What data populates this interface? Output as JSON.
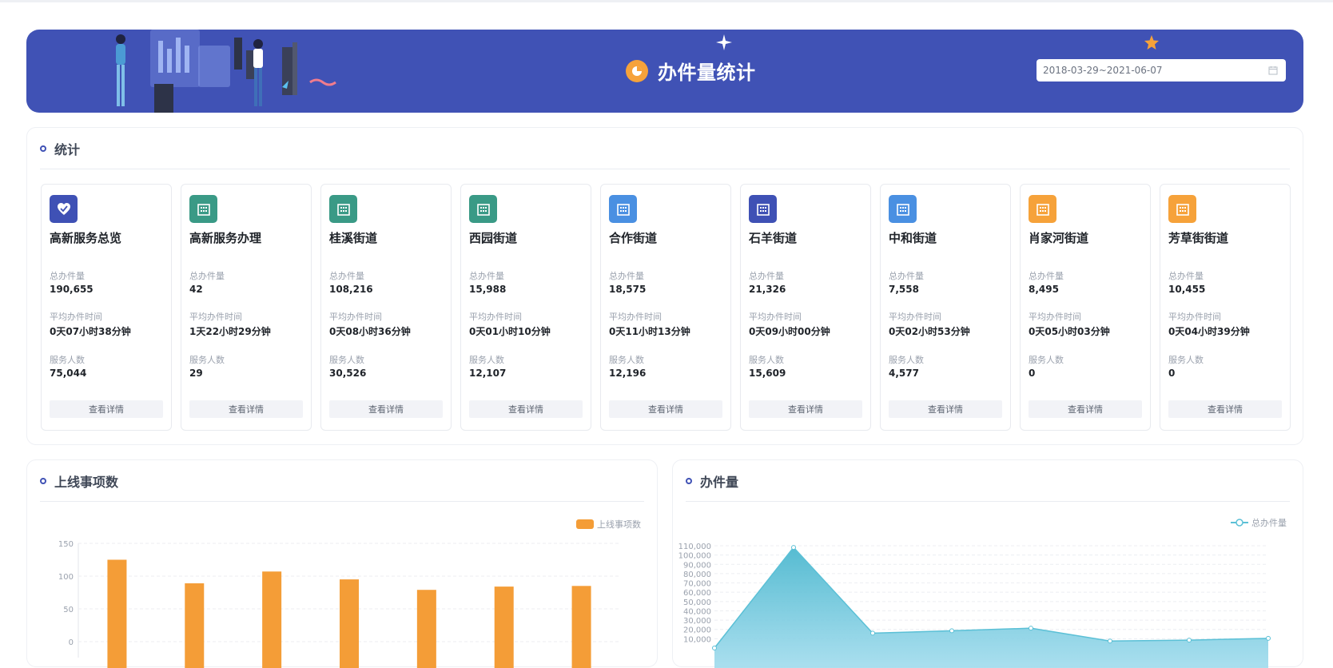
{
  "header": {
    "title": "办件量统计",
    "date_range": "2018-03-29~2021-06-07"
  },
  "stats": {
    "title": "统计",
    "label_total": "总办件量",
    "label_avg": "平均办件时间",
    "label_people": "服务人数",
    "detail_label": "查看详情",
    "cards": [
      {
        "name": "高新服务总览",
        "icon": "heart-icon",
        "color": "#3f51b5",
        "total": "190,655",
        "avg": "0天07小时38分钟",
        "people": "75,044"
      },
      {
        "name": "高新服务办理",
        "icon": "building-icon",
        "color": "#3a9a86",
        "total": "42",
        "avg": "1天22小时29分钟",
        "people": "29"
      },
      {
        "name": "桂溪街道",
        "icon": "building-icon",
        "color": "#3a9a86",
        "total": "108,216",
        "avg": "0天08小时36分钟",
        "people": "30,526"
      },
      {
        "name": "西园街道",
        "icon": "building-icon",
        "color": "#3a9a86",
        "total": "15,988",
        "avg": "0天01小时10分钟",
        "people": "12,107"
      },
      {
        "name": "合作街道",
        "icon": "building-icon",
        "color": "#4a90e2",
        "total": "18,575",
        "avg": "0天11小时13分钟",
        "people": "12,196"
      },
      {
        "name": "石羊街道",
        "icon": "building-icon",
        "color": "#3f51b5",
        "total": "21,326",
        "avg": "0天09小时00分钟",
        "people": "15,609"
      },
      {
        "name": "中和街道",
        "icon": "building-icon",
        "color": "#4a90e2",
        "total": "7,558",
        "avg": "0天02小时53分钟",
        "people": "4,577"
      },
      {
        "name": "肖家河街道",
        "icon": "building-icon",
        "color": "#f6a23a",
        "total": "8,495",
        "avg": "0天05小时03分钟",
        "people": "0"
      },
      {
        "name": "芳草街街道",
        "icon": "building-icon",
        "color": "#f6a23a",
        "total": "10,455",
        "avg": "0天04小时39分钟",
        "people": "0"
      }
    ]
  },
  "charts": {
    "left_title": "上线事项数",
    "right_title": "办件量"
  },
  "chart_data": [
    {
      "type": "bar",
      "title": "上线事项数",
      "series": [
        {
          "name": "上线事项数",
          "values": [
            125,
            89,
            107,
            95,
            79,
            84,
            85
          ],
          "color": "#f49d37"
        }
      ],
      "y_ticks": [
        "150",
        "100",
        "50",
        "0"
      ],
      "ylim": [
        0,
        150
      ],
      "legend": "top-right",
      "grid": true
    },
    {
      "type": "area",
      "title": "办件量",
      "series": [
        {
          "name": "总办件量",
          "values": [
            0,
            108216,
            15988,
            18575,
            21326,
            7558,
            8495,
            10455
          ],
          "color": "#5bc0d6"
        }
      ],
      "y_ticks": [
        "110,000",
        "100,000",
        "90,000",
        "80,000",
        "70,000",
        "60,000",
        "50,000",
        "40,000",
        "30,000",
        "20,000",
        "10,000"
      ],
      "ylim": [
        0,
        110000
      ],
      "legend": "top-right",
      "grid": true
    }
  ]
}
